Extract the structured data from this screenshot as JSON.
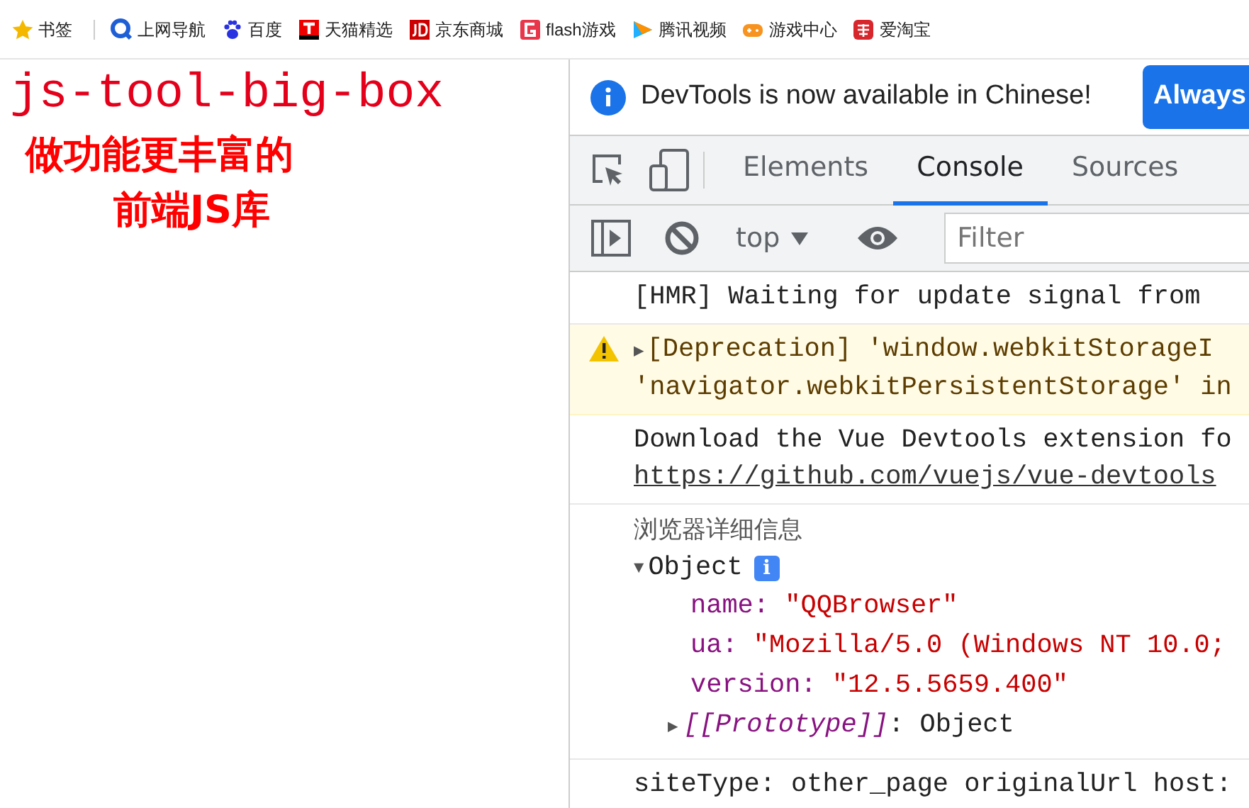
{
  "bookmarks": [
    {
      "label": "书签"
    },
    {
      "label": "上网导航"
    },
    {
      "label": "百度"
    },
    {
      "label": "天猫精选"
    },
    {
      "label": "京东商城"
    },
    {
      "label": "flash游戏"
    },
    {
      "label": "腾讯视频"
    },
    {
      "label": "游戏中心"
    },
    {
      "label": "爱淘宝"
    }
  ],
  "page": {
    "title": "js-tool-big-box",
    "subtitle_lines": [
      "做功能更丰富的",
      "前端JS库"
    ]
  },
  "devtools": {
    "banner": {
      "text": "DevTools is now available in Chinese!",
      "button": "Always"
    },
    "tabs": [
      {
        "label": "Elements",
        "selected": false
      },
      {
        "label": "Console",
        "selected": true
      },
      {
        "label": "Sources",
        "selected": false
      }
    ],
    "context": "top",
    "filter": {
      "placeholder": "Filter"
    },
    "messages": [
      {
        "kind": "log",
        "lines": [
          "[HMR] Waiting for update signal from"
        ]
      },
      {
        "kind": "warning",
        "toggle": "▶",
        "lines": [
          "[Deprecation] 'window.webkitStorageI",
          "'navigator.webkitPersistentStorage' in"
        ]
      },
      {
        "kind": "link",
        "lines": [
          "Download the Vue Devtools extension fo"
        ],
        "link": "https://github.com/vuejs/vue-devtools"
      },
      {
        "kind": "group",
        "label": "浏览器详细信息",
        "toggle": "▼",
        "object": "Object",
        "info": "i",
        "props": [
          {
            "key": "name:",
            "value": "\"QQBrowser\""
          },
          {
            "key": "ua:",
            "value": "\"Mozilla/5.0 (Windows NT 10.0;"
          },
          {
            "key": "version:",
            "value": "\"12.5.5659.400\""
          }
        ],
        "proto_toggle": "▶",
        "proto": "[[Prototype]]",
        "proto_value": ": Object"
      },
      {
        "kind": "log",
        "lines": [
          "siteType: other_page originalUrl host:"
        ]
      }
    ]
  }
}
